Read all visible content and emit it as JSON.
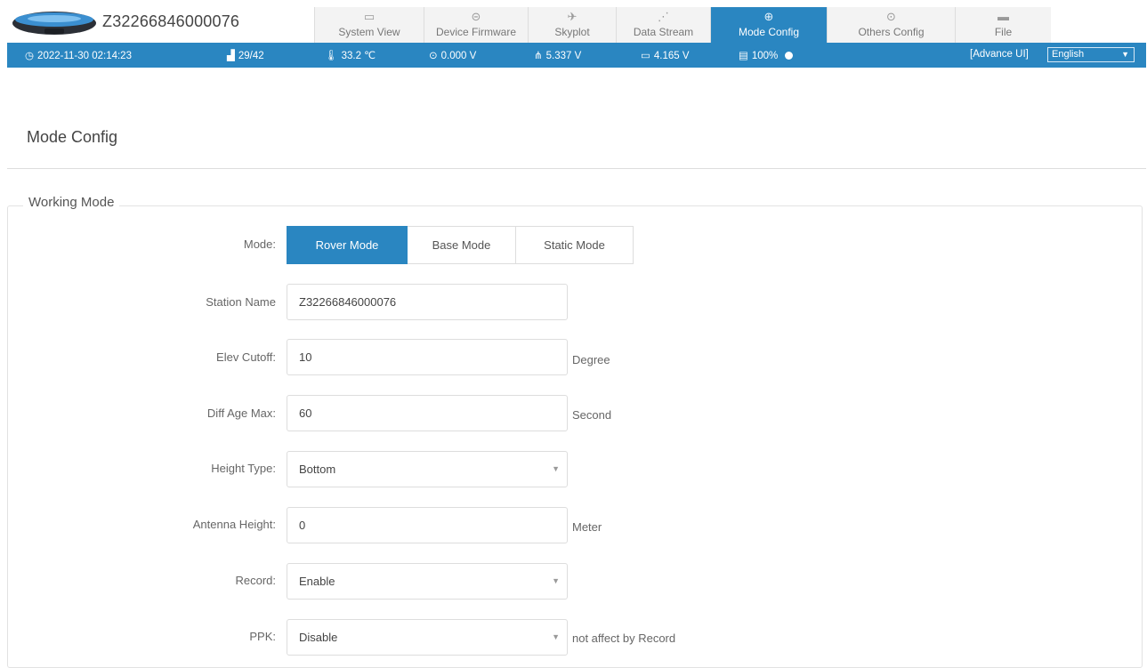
{
  "header": {
    "device_icon": "gnss-receiver-icon",
    "device_name": "Z32266846000076",
    "tabs": [
      {
        "label": "System View",
        "icon": "monitor-icon",
        "glyph": "▭"
      },
      {
        "label": "Device Firmware",
        "icon": "firmware-icon",
        "glyph": "⊝"
      },
      {
        "label": "Skyplot",
        "icon": "satellite-icon",
        "glyph": "✈"
      },
      {
        "label": "Data Stream",
        "icon": "wave-icon",
        "glyph": "⋰"
      },
      {
        "label": "Mode Config",
        "icon": "mode-icon",
        "glyph": "⊕"
      },
      {
        "label": "Others Config",
        "icon": "settings-icon",
        "glyph": "⊙"
      },
      {
        "label": "File",
        "icon": "folder-icon",
        "glyph": "▬"
      }
    ],
    "active_tab": "Mode Config"
  },
  "status": {
    "datetime": "2022-11-30 02:14:23",
    "satellites": "29/42",
    "temperature": "33.2 ℃",
    "voltage_1": "0.000 V",
    "voltage_2": "5.337 V",
    "battery": "4.165 V",
    "storage": "100%",
    "advance_ui": "[Advance UI]",
    "language": "English"
  },
  "page": {
    "title": "Mode Config",
    "section_title": "Working Mode"
  },
  "form": {
    "mode_label": "Mode:",
    "modes": [
      "Rover Mode",
      "Base Mode",
      "Static Mode"
    ],
    "active_mode": "Rover Mode",
    "station_name_label": "Station Name",
    "station_name": "Z32266846000076",
    "elev_cutoff_label": "Elev Cutoff:",
    "elev_cutoff": "10",
    "elev_cutoff_unit": "Degree",
    "diff_age_label": "Diff Age Max:",
    "diff_age": "60",
    "diff_age_unit": "Second",
    "height_type_label": "Height Type:",
    "height_type": "Bottom",
    "antenna_height_label": "Antenna Height:",
    "antenna_height": "0",
    "antenna_height_unit": "Meter",
    "record_label": "Record:",
    "record": "Enable",
    "ppk_label": "PPK:",
    "ppk": "Disable",
    "ppk_note": "not affect by Record"
  },
  "colors": {
    "accent": "#2a86c1",
    "tab_bg": "#f3f3f3"
  }
}
